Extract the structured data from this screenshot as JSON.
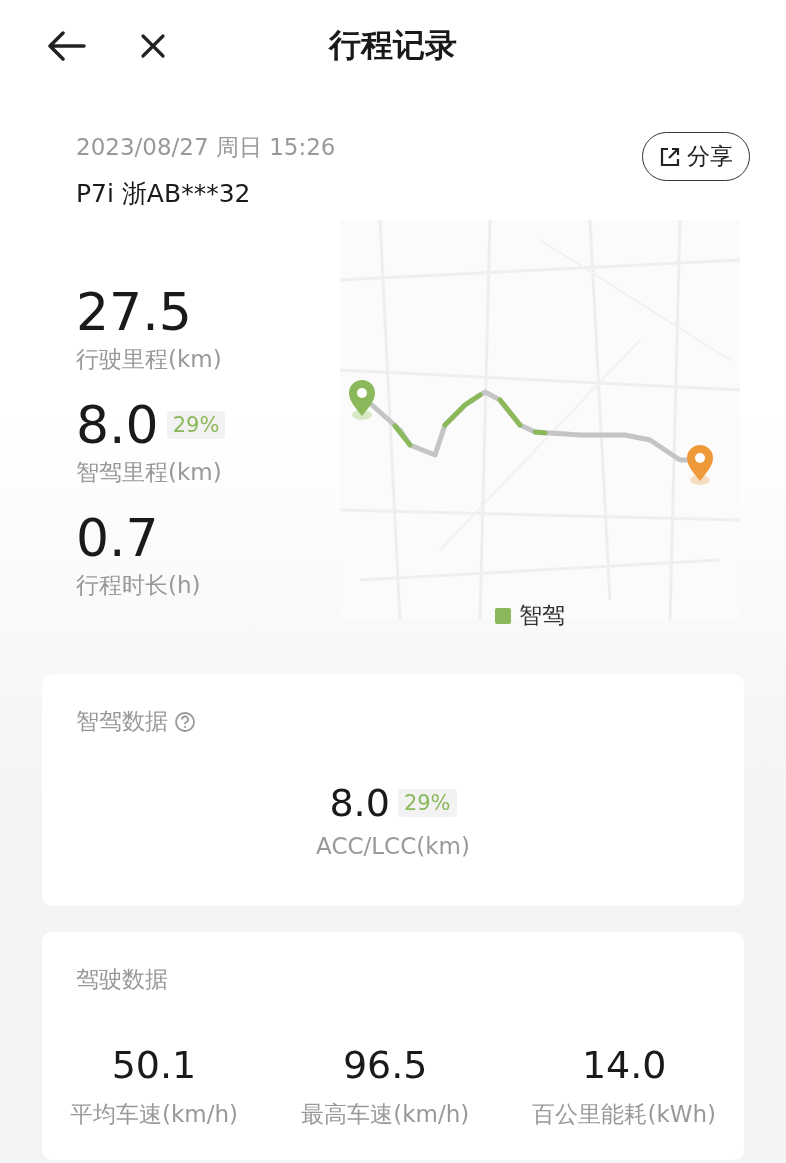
{
  "header": {
    "title": "行程记录"
  },
  "trip": {
    "datetime": "2023/08/27 周日 15:26",
    "vehicle": "P7i 浙AB***32",
    "share": "分享"
  },
  "stats": [
    {
      "value": "27.5",
      "label": "行驶里程(km)"
    },
    {
      "value": "8.0",
      "badge": "29%",
      "label": "智驾里程(km)"
    },
    {
      "value": "0.7",
      "label": "行程时长(h)"
    }
  ],
  "map": {
    "legend": [
      {
        "label": "智驾",
        "color": "#8bb85a"
      }
    ]
  },
  "smart_card": {
    "title": "智驾数据",
    "value": "8.0",
    "badge": "29%",
    "label": "ACC/LCC(km)"
  },
  "drive_card": {
    "title": "驾驶数据",
    "metrics": [
      {
        "value": "50.1",
        "label": "平均车速(km/h)"
      },
      {
        "value": "96.5",
        "label": "最高车速(km/h)"
      },
      {
        "value": "14.0",
        "label": "百公里能耗(kWh)"
      }
    ]
  }
}
